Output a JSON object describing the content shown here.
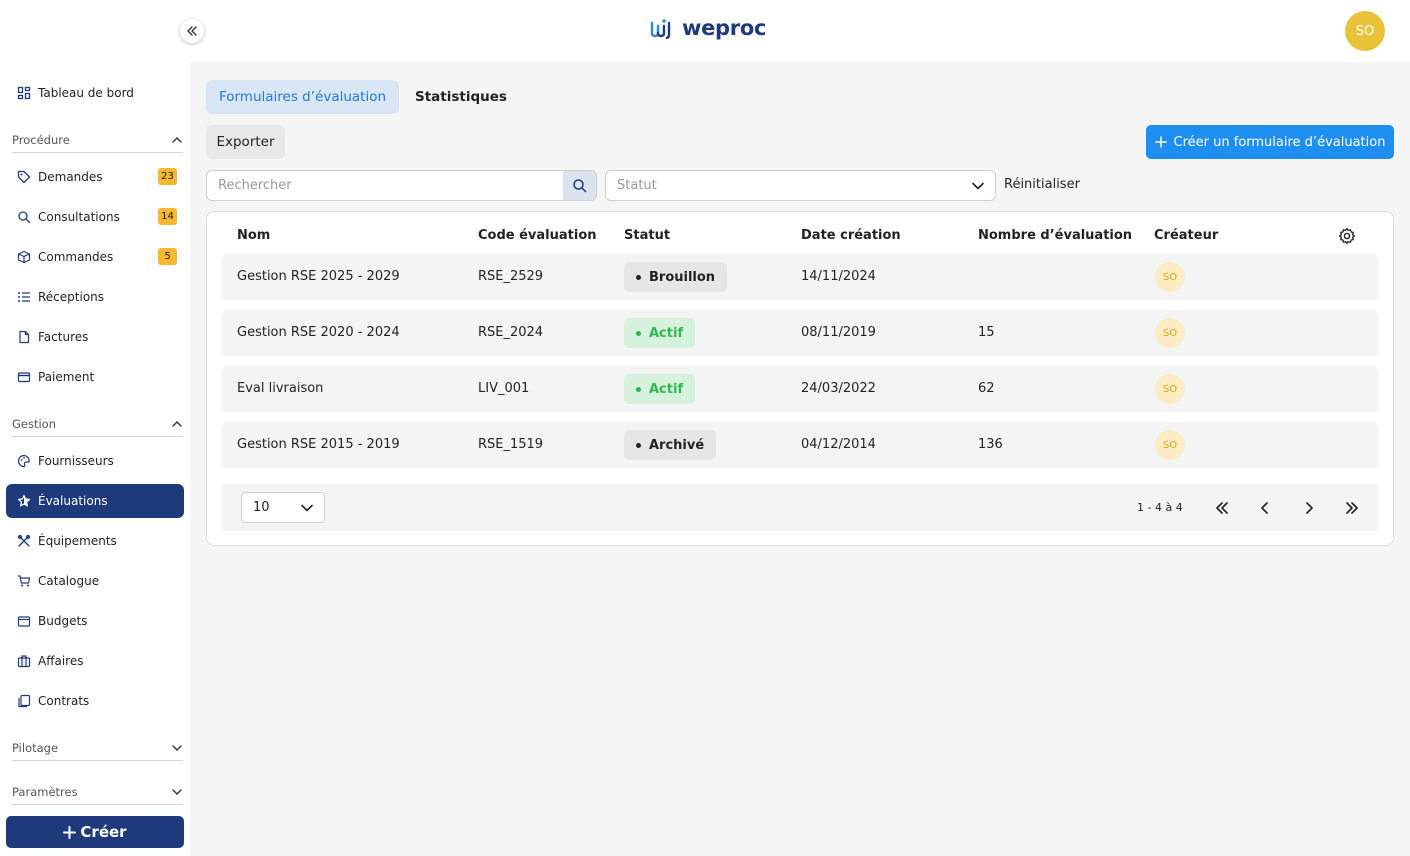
{
  "header": {
    "logo_text": "weproc",
    "user_initials": "SO"
  },
  "sidebar": {
    "dashboard": "Tableau de bord",
    "sections": {
      "procedure": "Procédure",
      "gestion": "Gestion",
      "pilotage": "Pilotage",
      "parametres": "Paramètres"
    },
    "procedure_items": [
      {
        "label": "Demandes",
        "badge": "23",
        "icon": "tag-icon"
      },
      {
        "label": "Consultations",
        "badge": "14",
        "icon": "search-icon"
      },
      {
        "label": "Commandes",
        "badge": "5",
        "icon": "box-icon"
      },
      {
        "label": "Réceptions",
        "icon": "list-icon"
      },
      {
        "label": "Factures",
        "icon": "document-icon"
      },
      {
        "label": "Paiement",
        "icon": "card-icon"
      }
    ],
    "gestion_items": [
      {
        "label": "Fournisseurs",
        "icon": "palette-icon"
      },
      {
        "label": "Évaluations",
        "icon": "star-icon",
        "active": true
      },
      {
        "label": "Équipements",
        "icon": "tools-icon"
      },
      {
        "label": "Catalogue",
        "icon": "cart-icon"
      },
      {
        "label": "Budgets",
        "icon": "wallet-icon"
      },
      {
        "label": "Affaires",
        "icon": "briefcase-icon"
      },
      {
        "label": "Contrats",
        "icon": "copy-icon"
      }
    ],
    "create_label": "Créer"
  },
  "tabs": {
    "active": "Formulaires d’évaluation",
    "other": "Statistiques"
  },
  "toolbar": {
    "export_label": "Exporter",
    "add_label": "Créer un formulaire d’évaluation"
  },
  "filters": {
    "search_placeholder": "Rechercher",
    "status_placeholder": "Statut",
    "reset_label": "Réinitialiser"
  },
  "table": {
    "columns": [
      "Nom",
      "Code évaluation",
      "Statut",
      "Date création",
      "Nombre d’évaluation",
      "Créateur"
    ],
    "rows": [
      {
        "name": "Gestion RSE 2025 - 2029",
        "code": "RSE_2529",
        "status": "Brouillon",
        "status_kind": "draft",
        "date": "14/11/2024",
        "count": "",
        "creator": "SO"
      },
      {
        "name": "Gestion RSE 2020 - 2024",
        "code": "RSE_2024",
        "status": "Actif",
        "status_kind": "active",
        "date": "08/11/2019",
        "count": "15",
        "creator": "SO"
      },
      {
        "name": "Eval livraison",
        "code": "LIV_001",
        "status": "Actif",
        "status_kind": "active",
        "date": "24/03/2022",
        "count": "62",
        "creator": "SO"
      },
      {
        "name": "Gestion RSE 2015 - 2019",
        "code": "RSE_1519",
        "status": "Archivé",
        "status_kind": "draft",
        "date": "04/12/2014",
        "count": "136",
        "creator": "SO"
      }
    ]
  },
  "pagination": {
    "page_size": "10",
    "range_text": "1 - 4 à 4"
  },
  "colors": {
    "primary_navy": "#1e3a7b",
    "accent_blue": "#1e8ef0",
    "active_green": "#2fb84f",
    "badge_yellow": "#f5b82e",
    "avatar_yellow": "#e8c33a"
  }
}
